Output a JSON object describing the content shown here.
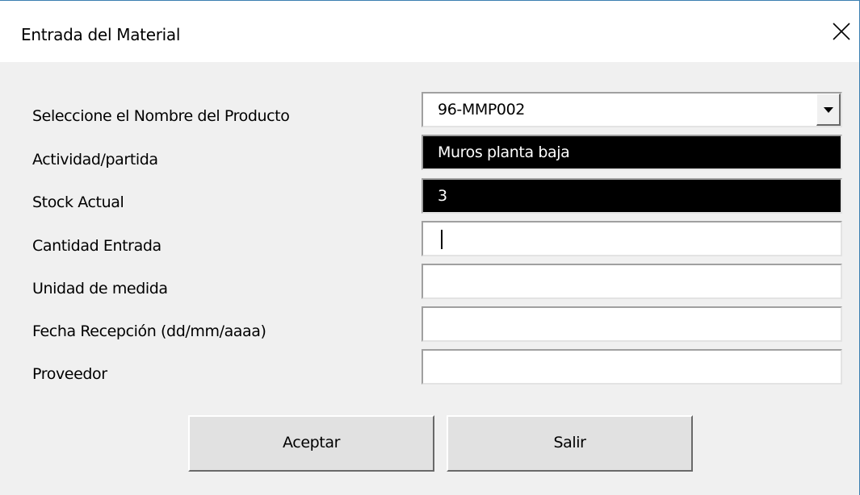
{
  "window": {
    "title": "Entrada del Material"
  },
  "form": {
    "fields": [
      {
        "label": "Seleccione el Nombre del Producto",
        "value": "96-MMP002",
        "type": "combobox"
      },
      {
        "label": "Actividad/partida",
        "value": "Muros planta baja",
        "type": "readonly"
      },
      {
        "label": "Stock Actual",
        "value": "3",
        "type": "readonly"
      },
      {
        "label": "Cantidad Entrada",
        "value": "",
        "type": "text",
        "focused": true
      },
      {
        "label": "Unidad de medida",
        "value": "",
        "type": "text"
      },
      {
        "label": "Fecha Recepción (dd/mm/aaaa)",
        "value": "",
        "type": "text"
      },
      {
        "label": "Proveedor",
        "value": "",
        "type": "text"
      }
    ]
  },
  "buttons": {
    "accept_label": "Aceptar",
    "exit_label": "Salir"
  },
  "icons": {
    "close": "close-icon",
    "dropdown": "chevron-down-icon"
  },
  "colors": {
    "readonly_background": "#000000",
    "readonly_text": "#ffffff",
    "window_border": "#3c7fb1"
  }
}
